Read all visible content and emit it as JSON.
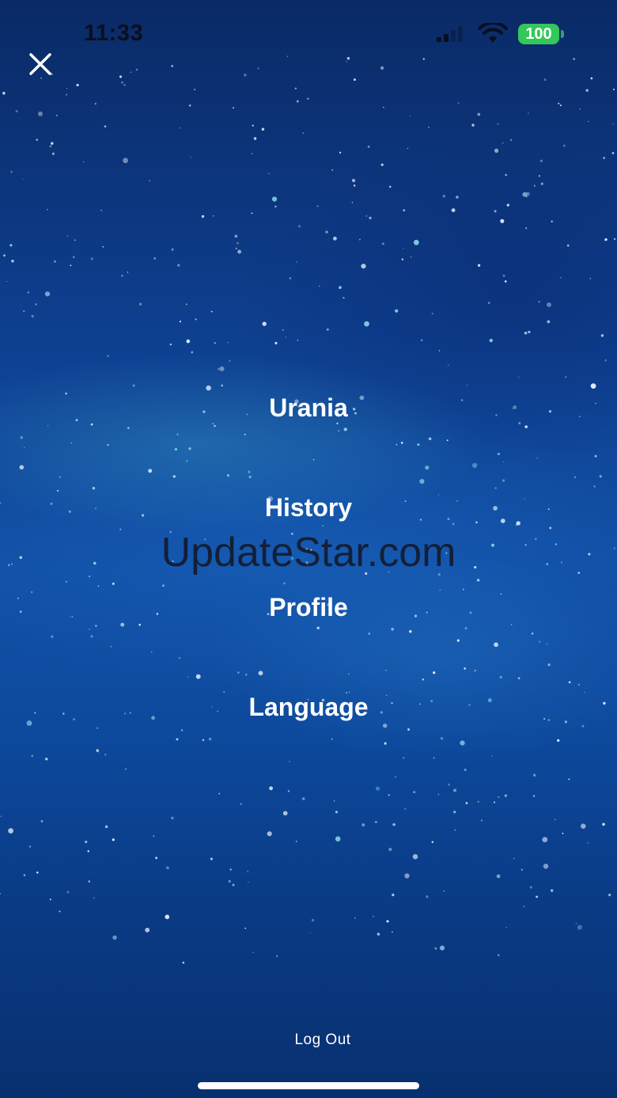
{
  "status_bar": {
    "time": "11:33",
    "battery_level": "100",
    "battery_color": "#34c759"
  },
  "close_icon": "close-icon",
  "menu": {
    "items": [
      {
        "label": "Urania"
      },
      {
        "label": "History"
      },
      {
        "label": "Profile"
      },
      {
        "label": "Language"
      }
    ]
  },
  "watermark": "UpdateStar.com",
  "logout_label": "Log Out",
  "colors": {
    "background_top": "#0a2a66",
    "background_mid": "#1150a6",
    "text": "#ffffff"
  }
}
